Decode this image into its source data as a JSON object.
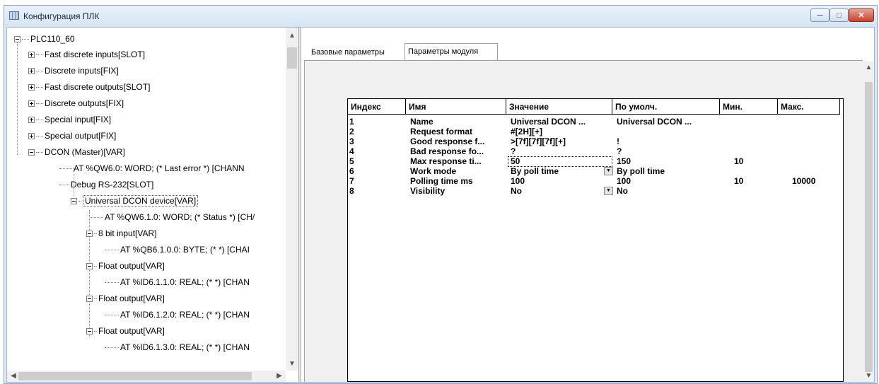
{
  "window": {
    "title": "Конфигурация ПЛК"
  },
  "tree": {
    "root": "PLC110_60",
    "items": [
      "Fast discrete inputs[SLOT]",
      "Discrete inputs[FIX]",
      "Fast discrete outputs[SLOT]",
      "Discrete outputs[FIX]",
      "Special input[FIX]",
      "Special output[FIX]",
      "DCON (Master)[VAR]",
      "AT %QW6.0: WORD; (* Last error *) [CHANN",
      "Debug RS-232[SLOT]",
      "Universal DCON device[VAR]",
      "AT %QW6.1.0: WORD; (* Status *) [CH/",
      "8 bit input[VAR]",
      "AT %QB6.1.0.0: BYTE; (*  *) [CHAI",
      "Float output[VAR]",
      "AT %ID6.1.1.0: REAL; (*  *) [CHAN",
      "Float output[VAR]",
      "AT %ID6.1.2.0: REAL; (*  *) [CHAN",
      "Float output[VAR]",
      "AT %ID6.1.3.0: REAL; (*  *) [CHAN"
    ]
  },
  "tabs": [
    "Базовые параметры",
    "Параметры модуля"
  ],
  "table": {
    "headers": [
      "Индекс",
      "Имя",
      "Значение",
      "По умолч.",
      "Мин.",
      "Макс."
    ],
    "rows": [
      [
        "1",
        "Name",
        "Universal DCON ...",
        "Universal DCON ...",
        "",
        ""
      ],
      [
        "2",
        "Request format",
        "#[2H][+]",
        "",
        "",
        ""
      ],
      [
        "3",
        "Good response f...",
        ">[7f][7f][7f][+]",
        "!",
        "",
        ""
      ],
      [
        "4",
        "Bad response fo...",
        "?",
        "?",
        "",
        ""
      ],
      [
        "5",
        "Max response ti...",
        "50",
        "150",
        "10",
        ""
      ],
      [
        "6",
        "Work mode",
        "By poll time",
        "By poll time",
        "",
        ""
      ],
      [
        "7",
        "Polling time ms",
        "100",
        "100",
        "10",
        "10000"
      ],
      [
        "8",
        "Visibility",
        "No",
        "No",
        "",
        ""
      ]
    ]
  }
}
